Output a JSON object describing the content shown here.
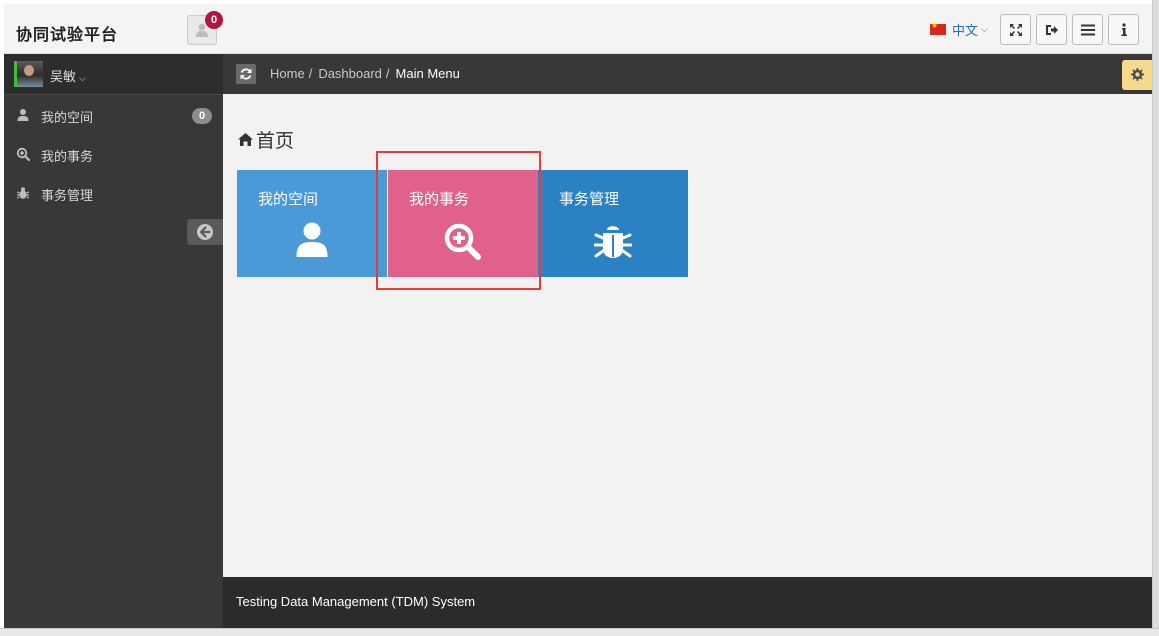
{
  "header": {
    "brand": "协同试验平台",
    "notification_count": "0",
    "language_label": "中文",
    "buttons": [
      "fullscreen-icon",
      "logout-icon",
      "menu-icon",
      "info-icon"
    ]
  },
  "sidebar": {
    "user_name": "吴敏",
    "items": [
      {
        "label": "我的空间",
        "icon": "user-icon",
        "count": "0"
      },
      {
        "label": "我的事务",
        "icon": "search-plus-icon"
      },
      {
        "label": "事务管理",
        "icon": "bug-icon"
      }
    ]
  },
  "breadcrumb": {
    "items": [
      "Home",
      "Dashboard"
    ],
    "separator": "/",
    "current": "Main Menu"
  },
  "main": {
    "title": "首页",
    "tiles": [
      {
        "label": "我的空间",
        "icon": "user-icon",
        "color": "#4a9ad8"
      },
      {
        "label": "我的事务",
        "icon": "search-plus-icon",
        "color": "#e0628a"
      },
      {
        "label": "事务管理",
        "icon": "bug-icon",
        "color": "#2a82c4"
      }
    ]
  },
  "footer": {
    "text": "Testing Data Management (TDM) System"
  },
  "colors": {
    "sidebar_bg": "#3a3836",
    "footer_bg": "#2d2b29",
    "badge_red": "#b0173f",
    "settings_yellow": "#f6d98a",
    "highlight_red": "#e83a3a"
  }
}
